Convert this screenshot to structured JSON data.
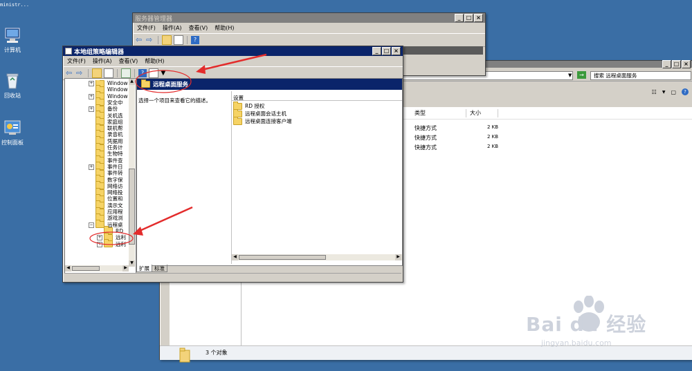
{
  "desktop": {
    "topleft_text": "ministr...",
    "icons": [
      {
        "label": "计算机"
      },
      {
        "label": "回收站"
      },
      {
        "label": "控制面板"
      }
    ]
  },
  "server_manager": {
    "title": "服务器管理器",
    "menu": [
      "文件(F)",
      "操作(A)",
      "查看(V)",
      "帮助(H)"
    ]
  },
  "explorer": {
    "search_text": "搜索 远程桌面服务",
    "columns": [
      "类型",
      "大小"
    ],
    "rows": [
      {
        "type": "快捷方式",
        "size": "2 KB"
      },
      {
        "type": "快捷方式",
        "size": "2 KB"
      },
      {
        "type": "快捷方式",
        "size": "2 KB"
      }
    ],
    "status": "3 个对象"
  },
  "gpedit": {
    "title": "本地组策略编辑器",
    "menu": [
      "文件(F)",
      "操作(A)",
      "查看(V)",
      "帮助(H)"
    ],
    "header_title": "远程桌面服务",
    "description": "选择一个项目来查看它的描述。",
    "settings_header": "设置",
    "settings": [
      "RD 授权",
      "远程桌面会话主机",
      "远程桌面连接客户端"
    ],
    "tabs": [
      "扩展",
      "标准"
    ],
    "tree": [
      {
        "label": "Window",
        "expander": "+"
      },
      {
        "label": "Window",
        "expander": ""
      },
      {
        "label": "Window",
        "expander": "+"
      },
      {
        "label": "安全中",
        "expander": ""
      },
      {
        "label": "备份",
        "expander": "+"
      },
      {
        "label": "关机选",
        "expander": ""
      },
      {
        "label": "家庭组",
        "expander": ""
      },
      {
        "label": "联机帮",
        "expander": ""
      },
      {
        "label": "录音机",
        "expander": ""
      },
      {
        "label": "凭据用",
        "expander": ""
      },
      {
        "label": "任务计",
        "expander": ""
      },
      {
        "label": "生物特",
        "expander": ""
      },
      {
        "label": "事件查",
        "expander": ""
      },
      {
        "label": "事件日",
        "expander": "+"
      },
      {
        "label": "事件转",
        "expander": ""
      },
      {
        "label": "数字保",
        "expander": ""
      },
      {
        "label": "网络访",
        "expander": ""
      },
      {
        "label": "网络投",
        "expander": ""
      },
      {
        "label": "位置和",
        "expander": ""
      },
      {
        "label": "演示文",
        "expander": ""
      },
      {
        "label": "应用程",
        "expander": ""
      },
      {
        "label": "游戏浏",
        "expander": ""
      },
      {
        "label": "远程桌",
        "expander": "−"
      },
      {
        "label": "RD",
        "expander": "",
        "indent": true
      },
      {
        "label": "远利",
        "expander": "+",
        "indent": true
      },
      {
        "label": "远利",
        "expander": "+",
        "indent": true
      }
    ]
  },
  "watermark": {
    "brand": "Bai du 经验",
    "url": "jingyan.baidu.com"
  },
  "colors": {
    "desktop": "#3a6ea5",
    "title_active": "#0a246a",
    "annotation_red": "#e32c2c"
  }
}
